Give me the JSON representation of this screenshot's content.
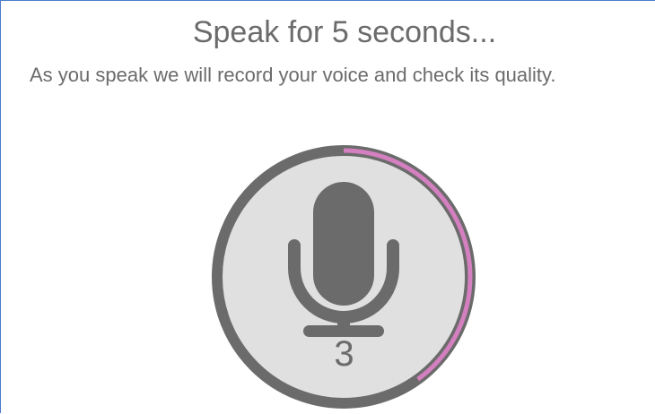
{
  "prompt": {
    "title": "Speak for 5 seconds...",
    "subtitle": "As you speak we will record your voice and check its quality."
  },
  "recorder": {
    "icon": "microphone-icon",
    "countdown": "3",
    "progress_fraction": 0.4,
    "colors": {
      "ring": "#6b6b6b",
      "progress": "#d47fbf",
      "face": "#e0e0e0",
      "icon": "#6b6b6b"
    }
  }
}
